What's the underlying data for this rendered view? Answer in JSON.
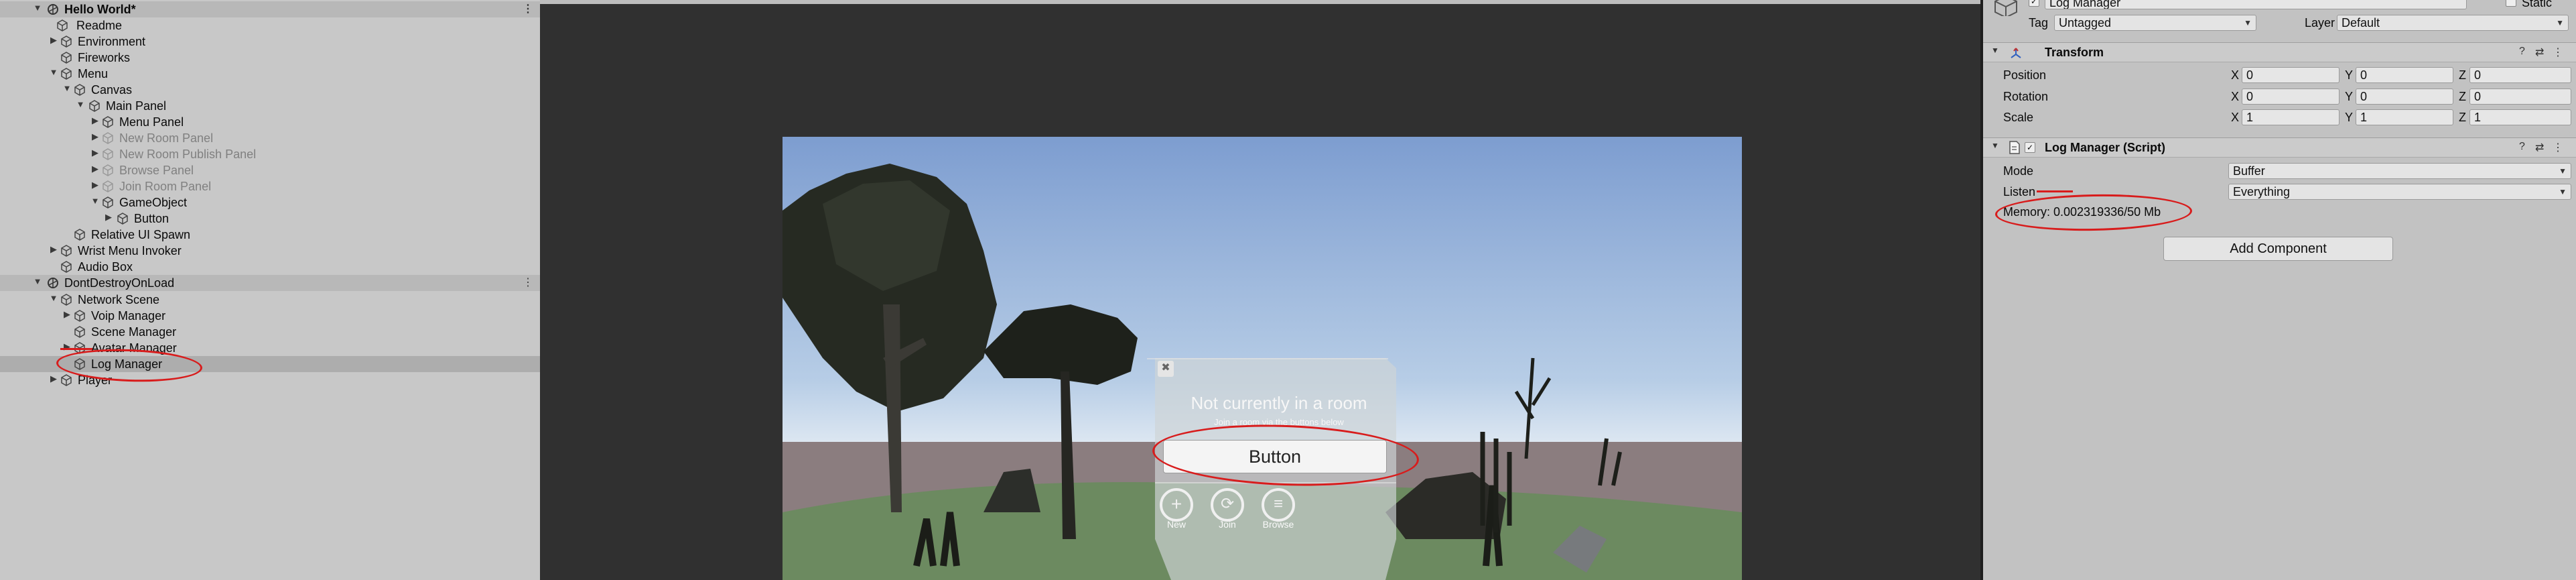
{
  "hierarchy": {
    "rows": [
      {
        "label": "Hello World*"
      },
      {
        "label": "Readme"
      },
      {
        "label": "Environment"
      },
      {
        "label": "Fireworks"
      },
      {
        "label": "Menu"
      },
      {
        "label": "Canvas"
      },
      {
        "label": "Main Panel"
      },
      {
        "label": "Menu Panel"
      },
      {
        "label": "New Room Panel"
      },
      {
        "label": "New Room Publish Panel"
      },
      {
        "label": "Browse Panel"
      },
      {
        "label": "Join Room Panel"
      },
      {
        "label": "GameObject"
      },
      {
        "label": "Button"
      },
      {
        "label": "Relative UI Spawn"
      },
      {
        "label": "Wrist Menu Invoker"
      },
      {
        "label": "Audio Box"
      },
      {
        "label": "DontDestroyOnLoad"
      },
      {
        "label": "Network Scene"
      },
      {
        "label": "Voip Manager"
      },
      {
        "label": "Scene Manager"
      },
      {
        "label": "Avatar Manager"
      },
      {
        "label": "Log Manager"
      },
      {
        "label": "Player"
      }
    ],
    "menu_glyph": "⋮"
  },
  "scene": {
    "ui_panel": {
      "title": "Not currently in a room",
      "subtitle": "Join a room via the buttons below",
      "button_label": "Button",
      "actions": [
        {
          "label": "New",
          "icon": "plus-icon"
        },
        {
          "label": "Join",
          "icon": "join-icon"
        },
        {
          "label": "Browse",
          "icon": "list-icon"
        }
      ]
    }
  },
  "inspector": {
    "object_name": "Log Manager",
    "static_label": "Static",
    "tag_label": "Tag",
    "tag_value": "Untagged",
    "layer_label": "Layer",
    "layer_value": "Default",
    "transform": {
      "title": "Transform",
      "rows": [
        {
          "label": "Position",
          "x": "0",
          "y": "0",
          "z": "0"
        },
        {
          "label": "Rotation",
          "x": "0",
          "y": "0",
          "z": "0"
        },
        {
          "label": "Scale",
          "x": "1",
          "y": "1",
          "z": "1"
        }
      ],
      "axis_x": "X",
      "axis_y": "Y",
      "axis_z": "Z"
    },
    "log_manager": {
      "title": "Log Manager (Script)",
      "mode_label": "Mode",
      "mode_value": "Buffer",
      "listen_label": "Listen",
      "listen_value": "Everything",
      "memory_text": "Memory: 0.002319336/50 Mb"
    },
    "add_component_label": "Add Component"
  },
  "colors": {
    "annotation": "#d81c1c",
    "scene_sky_top": "#7e9fd1",
    "scene_ground": "#6c8a60"
  }
}
